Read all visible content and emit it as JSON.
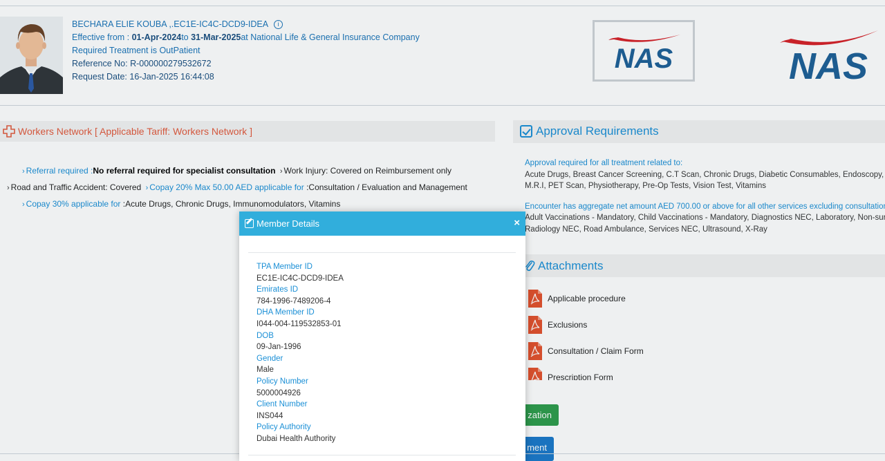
{
  "member": {
    "name": "BECHARA ELIE KOUBA ,.EC1E-IC4C-DCD9-IDEA",
    "effective_label": "Effective from : ",
    "effective_from": "01-Apr-2024",
    "to_label": "to ",
    "effective_to": "31-Mar-2025",
    "at_text": "at National Life & General Insurance Company",
    "treatment": "Required Treatment is OutPatient",
    "reference": "Reference No: R-000000279532672",
    "request_date": "Request Date: 16-Jan-2025 16:44:08"
  },
  "logos": {
    "small": "NAS",
    "big": "NAS",
    "brand_blue": "#1d5f96",
    "brand_red": "#d62027"
  },
  "network": {
    "title": "Workers Network [ Applicable Tariff: Workers Network ]",
    "referral_label": "Referral required :",
    "referral_value": "No referral required for specialist consultation",
    "work_injury": "Work Injury:  Covered on Reimbursement only",
    "road_accident": "Road and Traffic Accident: Covered",
    "copay20_label": "Copay 20% Max 50.00 AED applicable for",
    "copay20_value": ":Consultation / Evaluation and Management",
    "copay30_label": "Copay 30% applicable for",
    "copay30_value": ":Acute Drugs, Chronic Drugs, Immunomodulators, Vitamins"
  },
  "approval": {
    "title": "Approval Requirements",
    "line1_head": "Approval required for all treatment related to:",
    "line1_a": "Acute Drugs, Breast Cancer Screening, C.T Scan, Chronic Drugs, Diabetic Consumables, Endoscopy, Hear",
    "line1_b": "M.R.I, PET Scan, Physiotherapy, Pre-Op Tests, Vision Test, Vitamins",
    "line2_head": "Encounter has aggregate net amount AED 700.00 or above for all other services excluding consultation re",
    "line2_a": "Adult Vaccinations - Mandatory, Child Vaccinations - Mandatory, Diagnostics NEC, Laboratory, Non-surgic",
    "line2_b": "Radiology NEC, Road Ambulance, Services NEC, Ultrasound, X-Ray"
  },
  "attachments": {
    "title": "Attachments",
    "items": [
      "Applicable procedure",
      "Exclusions",
      "Consultation / Claim Form",
      "Prescription Form"
    ]
  },
  "buttons": {
    "green": "zation",
    "blue": "ment"
  },
  "modal": {
    "title": "Member Details",
    "close": "×",
    "fields": [
      {
        "label": "TPA Member ID",
        "value": "EC1E-IC4C-DCD9-IDEA"
      },
      {
        "label": "Emirates ID",
        "value": "784-1996-7489206-4"
      },
      {
        "label": "DHA Member ID",
        "value": "I044-004-119532853-01"
      },
      {
        "label": "DOB",
        "value": "09-Jan-1996"
      },
      {
        "label": "Gender",
        "value": "Male"
      },
      {
        "label": "Policy Number",
        "value": "5000004926"
      },
      {
        "label": "Client Number",
        "value": "INS044"
      },
      {
        "label": "Policy Authority",
        "value": "Dubai Health Authority"
      }
    ]
  }
}
